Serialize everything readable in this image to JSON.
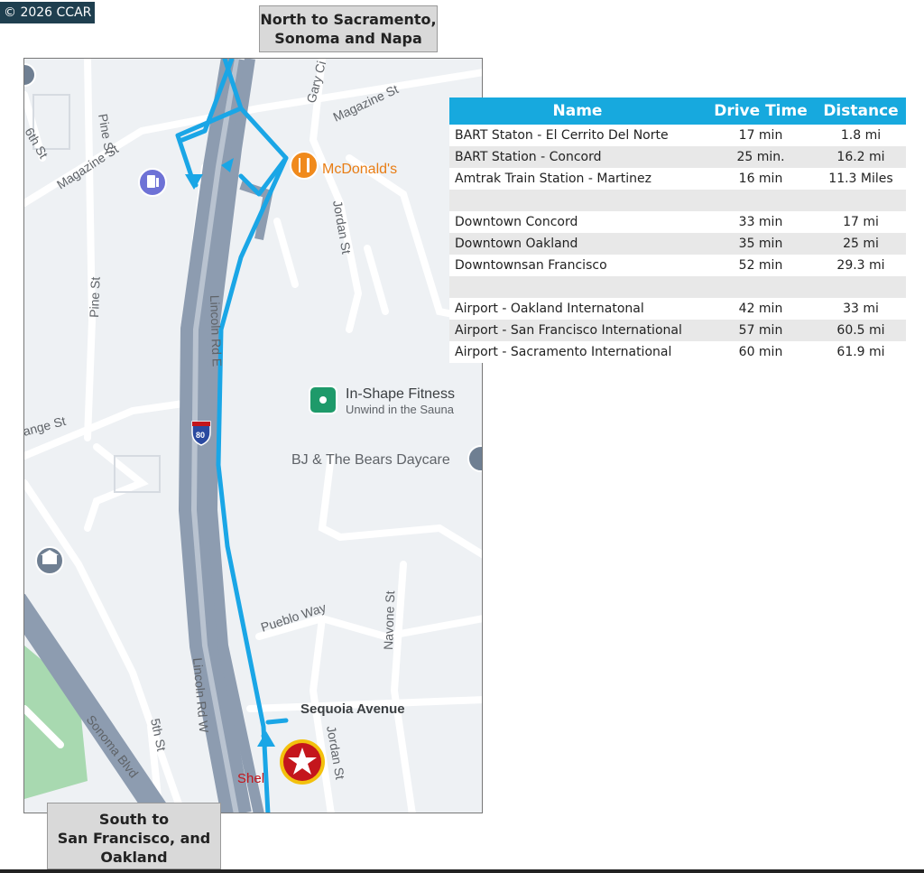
{
  "copyright": "© 2026 CCAR",
  "north_label": {
    "line1": "North to Sacramento,",
    "line2": "Sonoma and Napa"
  },
  "south_label": {
    "line1": "South to",
    "line2": "San Francisco, and",
    "line3": "Oakland"
  },
  "table": {
    "headers": {
      "name": "Name",
      "drive_time": "Drive Time",
      "distance": "Distance"
    },
    "rows": [
      {
        "name": "BART Staton - El Cerrito Del Norte",
        "time": "17 min",
        "distance": "1.8 mi"
      },
      {
        "name": "BART Station - Concord",
        "time": "25 min.",
        "distance": "16.2 mi"
      },
      {
        "name": "Amtrak Train Station - Martinez",
        "time": "16 min",
        "distance": "11.3 Miles"
      },
      {
        "name": "",
        "time": "",
        "distance": ""
      },
      {
        "name": "Downtown Concord",
        "time": "33 min",
        "distance": "17 mi"
      },
      {
        "name": "Downtown Oakland",
        "time": "35 min",
        "distance": "25 mi"
      },
      {
        "name": "Downtownsan Francisco",
        "time": "52 min",
        "distance": "29.3 mi"
      },
      {
        "name": "",
        "time": "",
        "distance": ""
      },
      {
        "name": "Airport - Oakland Internatonal",
        "time": "42 min",
        "distance": "33 mi"
      },
      {
        "name": "Airport - San Francisco International",
        "time": "57 min",
        "distance": "60.5 mi"
      },
      {
        "name": "Airport - Sacramento International",
        "time": "60 min",
        "distance": "61.9 mi"
      }
    ]
  },
  "map": {
    "streets": {
      "pine_st_1": "Pine St",
      "pine_st_2": "Pine St",
      "sixth_st": "6th St",
      "magazine_st_1": "Magazine St",
      "magazine_st_2": "Magazine St",
      "gary_ci": "Gary Ci",
      "jordan_st_1": "Jordan St",
      "jordan_st_2": "Jordan St",
      "lincoln_rd_e": "Lincoln Rd E",
      "range_st": "ange St",
      "pueblo_way": "Pueblo Way",
      "navone_st": "Navone St",
      "lincoln_rd_w": "Lincoln Rd W",
      "fifth_st": "5th St",
      "sonoma_blvd": "Sonoma Blvd",
      "sequoia_ave": "Sequoia Avenue"
    },
    "highway_shield": "80",
    "pois": {
      "mcdonalds": "McDonald's",
      "inshape_name": "In-Shape Fitness",
      "inshape_sub": "Unwind in the Sauna",
      "bj_bears": "BJ & The Bears Daycare",
      "shell": "Shel"
    },
    "colors": {
      "route": "#1aa6e6",
      "road": "#ffffff",
      "freeway": "#8d9cb0",
      "background": "#eef1f4",
      "park": "#a8d9b0",
      "mcdonalds_orange": "#f08a1c",
      "fitness_green": "#1e9a6a",
      "star_red": "#c4161c",
      "star_gold": "#f3c10d"
    },
    "icons": {
      "gas": "gas-station-icon",
      "food": "restaurant-icon",
      "fitness": "fitness-icon",
      "museum": "museum-icon",
      "star": "star-marker-icon"
    }
  }
}
